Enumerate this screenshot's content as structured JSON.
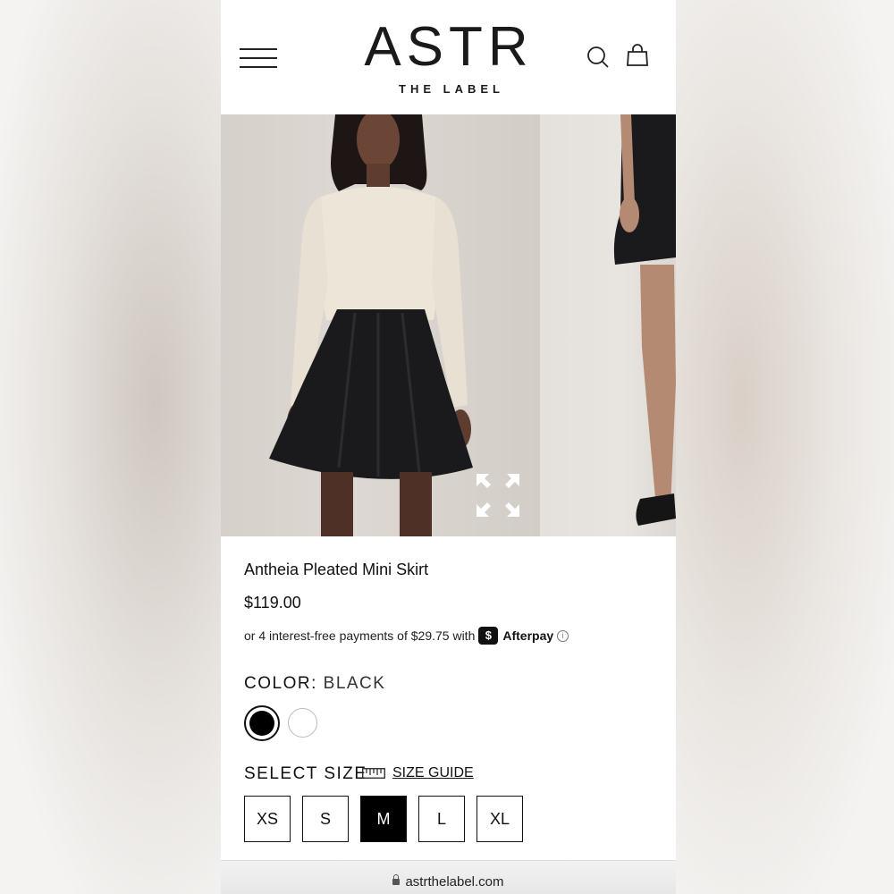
{
  "browser": {
    "url": "astrthelabel.com"
  },
  "header": {
    "logo_main": "ASTR",
    "logo_sub": "THE LABEL",
    "menu_icon": "hamburger-menu-icon",
    "search_icon": "search-icon",
    "bag_icon": "shopping-bag-icon"
  },
  "gallery": {
    "expand_icon": "fullscreen-expand-icon"
  },
  "product": {
    "title": "Antheia Pleated Mini Skirt",
    "price": "$119.00",
    "afterpay_text": "or 4 interest-free payments of $29.75 with",
    "afterpay_badge": "$",
    "afterpay_name": "Afterpay",
    "afterpay_info": "i"
  },
  "color": {
    "label": "COLOR:",
    "selected_value": "BLACK",
    "swatches": [
      "#000000",
      "#ffffff"
    ]
  },
  "size": {
    "label": "SELECT SIZE",
    "guide_label": "SIZE GUIDE",
    "options": [
      "XS",
      "S",
      "M",
      "L",
      "XL"
    ],
    "selected": "M"
  },
  "colors": {
    "text": "#111111",
    "background": "#ffffff",
    "selected": "#000000"
  }
}
